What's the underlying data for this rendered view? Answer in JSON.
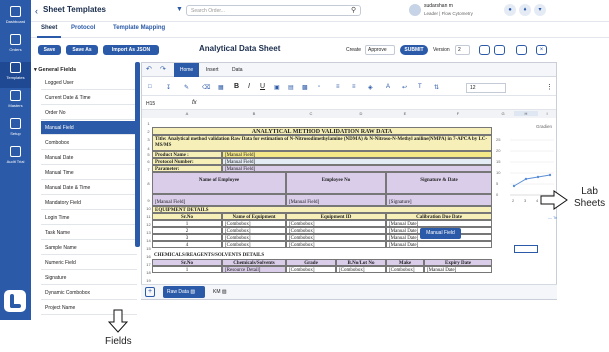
{
  "nav": {
    "items": [
      {
        "label": "Dashboard"
      },
      {
        "label": "Orders"
      },
      {
        "label": "Templates"
      },
      {
        "label": "Masters"
      },
      {
        "label": "Setup"
      },
      {
        "label": "Audit Trial"
      }
    ]
  },
  "header": {
    "title": "Sheet Templates",
    "search_placeholder": "Search Order...",
    "user_name": "sudarshan m",
    "user_role": "Leader | Flow Cytometry"
  },
  "tabs": {
    "sheet": "Sheet",
    "protocol": "Protocol",
    "template_mapping": "Template Mapping"
  },
  "toolbar": {
    "save": "Save",
    "save_as": "Save As",
    "import_json": "Import As JSON",
    "sheet_name": "Analytical Data Sheet",
    "create_label": "Create",
    "create_value": "Approve",
    "submit": "SUBMIT",
    "version_label": "Version",
    "version_value": "2"
  },
  "fields": {
    "group_label": "General Fields",
    "items": [
      "Logged User",
      "Current Date & Time",
      "Order No",
      "Manual Field",
      "Combobox",
      "Manual Date",
      "Manual Time",
      "Manual Date & Time",
      "Mandatory Field",
      "Login Time",
      "Task Name",
      "Sample Name",
      "Numeric Field",
      "Signature",
      "Dynamic Combobox",
      "Project Name"
    ],
    "active_index": 3
  },
  "spreadsheet": {
    "menu": [
      "Home",
      "Insert",
      "Data"
    ],
    "cell_ref": "H15",
    "fx": "fx",
    "font_size": "12",
    "columns": [
      "A",
      "B",
      "C",
      "D",
      "E",
      "F",
      "G",
      "H",
      "I"
    ],
    "rows": [
      "1",
      "2",
      "3",
      "4",
      "5",
      "6",
      "7",
      "8",
      "9",
      "10",
      "11",
      "12",
      "13",
      "14",
      "15",
      "16",
      "17",
      "18",
      "19",
      "20",
      "21"
    ],
    "title": "ANALYTICAL METHOD VALIDATION RAW DATA",
    "title_line": "Title: Analytical method validation Raw Data for estimation of N-Nitrosodimethylamine (NDMA) & N-Nitroso-N-Methyl aniline(NMPA) in 7-APCA by LC-MS/MS",
    "product_label": "Product Name :",
    "protocol_label": "Protocol Number:",
    "parameter_label": "Parameter:",
    "manual_field": "[Manual Field]",
    "employee_headers": [
      "Name of Employee",
      "Employee No",
      "Signature & Date"
    ],
    "employee_values": [
      "[Manual Field]",
      "[Manual Field]",
      "[Signature]"
    ],
    "equipment_title": "EQUIPMENT DETAILS",
    "equipment_headers": [
      "Sr.No",
      "Name of Equipment",
      "Equipment ID",
      "Calibration Due Date"
    ],
    "equipment_rows": [
      [
        "1",
        "[Combobox]",
        "[Combobox]",
        "[Manual Date]"
      ],
      [
        "2",
        "[Combobox]",
        "[Combobox]",
        "[Manual Date]"
      ],
      [
        "3",
        "[Combobox]",
        "[Combobox]",
        "[Manual Date]"
      ],
      [
        "4",
        "[Combobox]",
        "[Combobox]",
        "[Manual Date]"
      ]
    ],
    "chem_title": "CHEMICALS/REAGENTS/SOLVENTS DETAILS",
    "chem_headers": [
      "Sr.No",
      "Chemicals/Solvents",
      "Grade",
      "B.No/Lot No",
      "Make",
      "Expiry Date"
    ],
    "chem_rows": [
      [
        "1",
        "[Resource Detail]",
        "[Combobox]",
        "[Combobox]",
        "[Combobox]",
        "[Manual Date]"
      ]
    ],
    "tooltip": "Manual Field",
    "chart_label": "Gradien",
    "chart_yticks": [
      "25",
      "20",
      "15",
      "10",
      "5",
      "0"
    ],
    "chart_xticks": [
      "2",
      "3",
      "4",
      "5"
    ],
    "chart_legend": "Te",
    "sheet_tabs": [
      "Raw Data",
      "KM"
    ]
  },
  "annotations": {
    "lab": "Lab",
    "sheets": "Sheets",
    "fields": "Fields"
  }
}
